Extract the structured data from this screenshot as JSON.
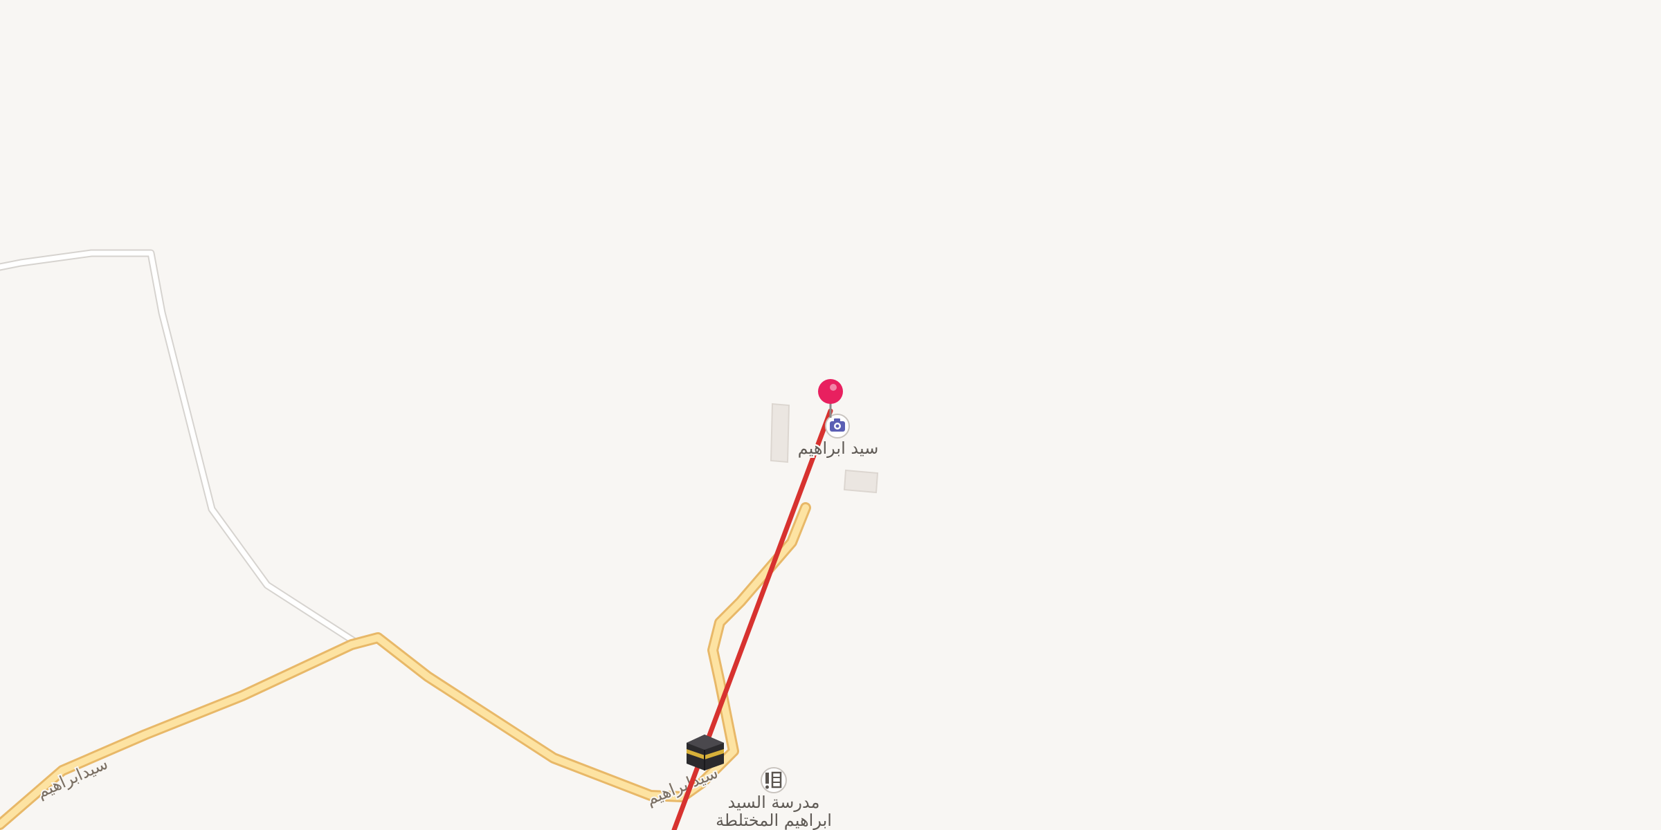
{
  "map": {
    "background_color": "#f8f6f3",
    "route_color": "#d7322f",
    "primary_road_color": "#fde3a2",
    "minor_road_color": "#ffffff",
    "pin_color": "#e8205f"
  },
  "pois": {
    "photo_spot": {
      "icon": "camera-icon",
      "label": "سيد ابراهيم"
    },
    "mosque": {
      "icon": "kaaba-icon"
    },
    "school": {
      "icon": "school-icon",
      "label_line1": "مدرسة السيد",
      "label_line2": "ابراهيم المختلطة"
    }
  },
  "roads": {
    "main_road_label_west": "سيدابراهيم",
    "main_road_label_south": "سيدابراهيم"
  },
  "marker": {
    "icon": "map-pin-icon"
  }
}
